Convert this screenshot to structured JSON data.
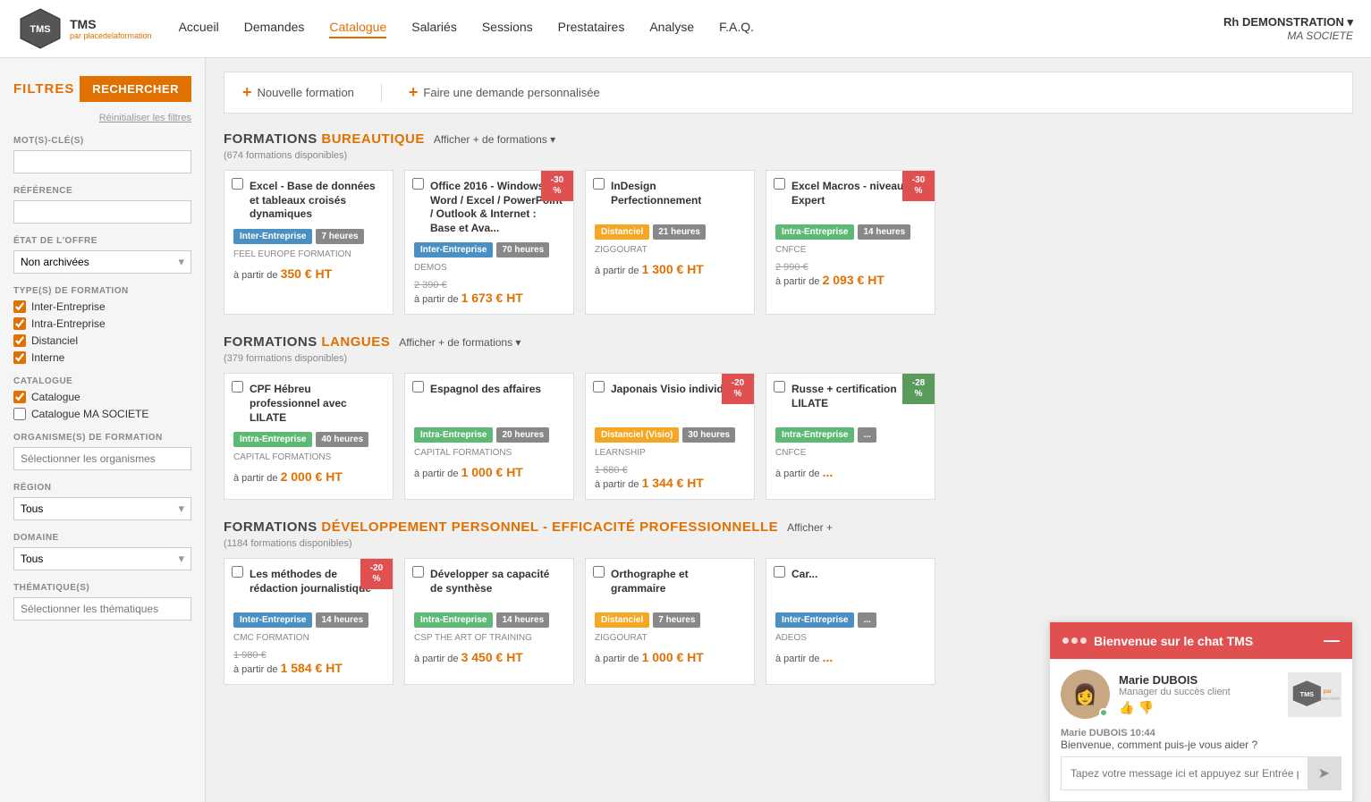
{
  "nav": {
    "logo_text": "TMS",
    "logo_sub": "par placedelaformation",
    "links": [
      {
        "label": "Accueil",
        "active": false
      },
      {
        "label": "Demandes",
        "active": false
      },
      {
        "label": "Catalogue",
        "active": true
      },
      {
        "label": "Salariés",
        "active": false
      },
      {
        "label": "Sessions",
        "active": false
      },
      {
        "label": "Prestataires",
        "active": false
      },
      {
        "label": "Analyse",
        "active": false
      },
      {
        "label": "F.A.Q.",
        "active": false
      }
    ],
    "user_name": "Rh DEMONSTRATION ▾",
    "user_company": "MA SOCIETE"
  },
  "sidebar": {
    "filtres_label": "FILTRES",
    "rechercher_label": "RECHERCHER",
    "reset_label": "Réinitialiser les filtres",
    "mots_cles_label": "MOT(S)-CLÉ(S)",
    "reference_label": "RÉFÉRENCE",
    "etat_offre_label": "ÉTAT DE L'OFFRE",
    "etat_offre_value": "Non archivées",
    "types_label": "TYPE(S) DE FORMATION",
    "types": [
      {
        "label": "Inter-Entreprise",
        "checked": true
      },
      {
        "label": "Intra-Entreprise",
        "checked": true
      },
      {
        "label": "Distanciel",
        "checked": true
      },
      {
        "label": "Interne",
        "checked": true
      }
    ],
    "catalogue_label": "CATALOGUE",
    "catalogues": [
      {
        "label": "Catalogue",
        "checked": true
      },
      {
        "label": "Catalogue MA SOCIETE",
        "checked": false
      }
    ],
    "organismes_label": "ORGANISME(S) DE FORMATION",
    "organismes_placeholder": "Sélectionner les organismes",
    "region_label": "RÉGION",
    "region_value": "Tous",
    "domaine_label": "DOMAINE",
    "domaine_value": "Tous",
    "thematiques_label": "THÉMATIQUE(S)",
    "thematiques_placeholder": "Sélectionner les thématiques"
  },
  "top_actions": {
    "nouvelle_label": "Nouvelle formation",
    "demande_label": "Faire une demande personnalisée"
  },
  "sections": [
    {
      "id": "bureautique",
      "title_prefix": "FORMATIONS ",
      "title_highlight": "BUREAUTIQUE",
      "more_label": "Afficher + de formations",
      "count": "(674 formations disponibles)",
      "cards": [
        {
          "title": "Excel - Base de données et tableaux croisés dynamiques",
          "badge_type": "Inter-Entreprise",
          "badge_color": "inter",
          "hours": "7 heures",
          "provider": "FEEL EUROPE FORMATION",
          "price_main": "350 € HT",
          "price_prefix": "à partir de",
          "price_old": null,
          "discount": null
        },
        {
          "title": "Office 2016 - Windows / Word / Excel / PowerPoint / Outlook & Internet : Base et Ava...",
          "badge_type": "Inter-Entreprise",
          "badge_color": "inter",
          "hours": "70 heures",
          "provider": "DEMOS",
          "price_main": "1 673 € HT",
          "price_prefix": "à partir de",
          "price_old": "2 390 €",
          "discount": "-30%"
        },
        {
          "title": "InDesign Perfectionnement",
          "badge_type": "Distanciel",
          "badge_color": "dist",
          "hours": "21 heures",
          "provider": "ZIGGOURAT",
          "price_main": "1 300 € HT",
          "price_prefix": "à partir de",
          "price_old": null,
          "discount": null
        },
        {
          "title": "Excel Macros - niveau Expert",
          "badge_type": "Intra-Entreprise",
          "badge_color": "intra",
          "hours": "14 heures",
          "provider": "CNFCE",
          "price_main": "2 093 € HT",
          "price_prefix": "à partir de",
          "price_old": "2 990 €",
          "discount": "-30%"
        }
      ]
    },
    {
      "id": "langues",
      "title_prefix": "FORMATIONS ",
      "title_highlight": "LANGUES",
      "more_label": "Afficher + de formations",
      "count": "(379 formations disponibles)",
      "cards": [
        {
          "title": "CPF Hébreu professionnel avec LILATE",
          "badge_type": "Intra-Entreprise",
          "badge_color": "intra",
          "hours": "40 heures",
          "provider": "CAPITAL FORMATIONS",
          "price_main": "2 000 € HT",
          "price_prefix": "à partir de",
          "price_old": null,
          "discount": null
        },
        {
          "title": "Espagnol des affaires",
          "badge_type": "Intra-Entreprise",
          "badge_color": "intra",
          "hours": "20 heures",
          "provider": "CAPITAL FORMATIONS",
          "price_main": "1 000 € HT",
          "price_prefix": "à partir de",
          "price_old": null,
          "discount": null
        },
        {
          "title": "Japonais Visio individuel",
          "badge_type": "Distanciel (Visio)",
          "badge_color": "dist",
          "hours": "30 heures",
          "provider": "LEARNSHIP",
          "price_main": "1 344 € HT",
          "price_prefix": "à partir de",
          "price_old": "1 680 €",
          "discount": "-20%"
        },
        {
          "title": "Russe + certification LILATE",
          "badge_type": "Intra-Entreprise",
          "badge_color": "intra",
          "hours": "...",
          "provider": "CNFCE",
          "price_main": "...",
          "price_prefix": "à partir de",
          "price_old": null,
          "discount": "-28%"
        }
      ]
    },
    {
      "id": "developpement",
      "title_prefix": "FORMATIONS ",
      "title_highlight": "DÉVELOPPEMENT PERSONNEL - EFFICACITÉ PROFESSIONNELLE",
      "more_label": "Afficher +",
      "count": "(1184 formations disponibles)",
      "cards": [
        {
          "title": "Les méthodes de rédaction journalistique",
          "badge_type": "Inter-Entreprise",
          "badge_color": "inter",
          "hours": "14 heures",
          "provider": "CMC Formation",
          "price_main": "1 584 € HT",
          "price_prefix": "à partir de",
          "price_old": "1 980 €",
          "discount": "-20%"
        },
        {
          "title": "Développer sa capacité de synthèse",
          "badge_type": "Intra-Entreprise",
          "badge_color": "intra",
          "hours": "14 heures",
          "provider": "CSP The art of training",
          "price_main": "3 450 € HT",
          "price_prefix": "à partir de",
          "price_old": null,
          "discount": null
        },
        {
          "title": "Orthographe et grammaire",
          "badge_type": "Distanciel",
          "badge_color": "dist",
          "hours": "7 heures",
          "provider": "ZIGGOURAT",
          "price_main": "1 000 € HT",
          "price_prefix": "à partir de",
          "price_old": null,
          "discount": null
        },
        {
          "title": "Car...",
          "badge_type": "Inter-Entreprise",
          "badge_color": "inter",
          "hours": "...",
          "provider": "ADEOS",
          "price_main": "...",
          "price_prefix": "à partir de",
          "price_old": null,
          "discount": null
        }
      ]
    }
  ],
  "chat": {
    "header_title": "Bienvenue sur le chat TMS",
    "agent_name": "Marie DUBOIS",
    "agent_role": "Manager du succès client",
    "message_time": "Marie DUBOIS 10:44",
    "message_text": "Bienvenue, comment puis-je vous aider ?",
    "input_placeholder": "Tapez votre message ici et appuyez sur Entrée pour l'envoyer"
  }
}
